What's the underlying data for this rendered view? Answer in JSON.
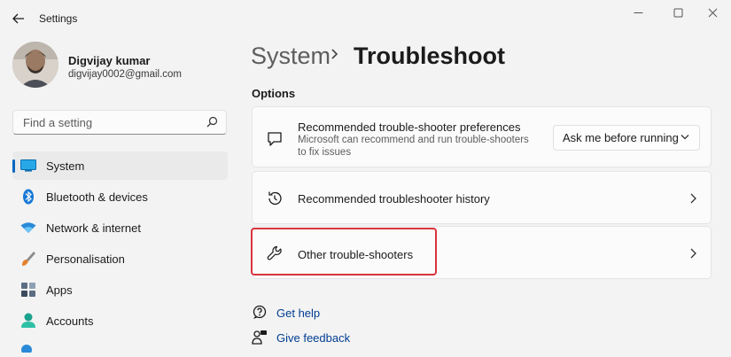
{
  "window": {
    "title": "Settings",
    "controls": [
      "minimize-icon",
      "maximize-icon",
      "close-icon"
    ]
  },
  "profile": {
    "name": "Digvijay kumar",
    "email": "digvijay0002@gmail.com"
  },
  "search": {
    "placeholder": "Find a setting",
    "value": ""
  },
  "nav": {
    "items": [
      {
        "label": "System",
        "icon": "system-display-icon",
        "active": true
      },
      {
        "label": "Bluetooth & devices",
        "icon": "bluetooth-icon",
        "active": false
      },
      {
        "label": "Network & internet",
        "icon": "wifi-icon",
        "active": false
      },
      {
        "label": "Personalisation",
        "icon": "paintbrush-icon",
        "active": false
      },
      {
        "label": "Apps",
        "icon": "apps-icon",
        "active": false
      },
      {
        "label": "Accounts",
        "icon": "person-icon",
        "active": false
      }
    ]
  },
  "breadcrumb": {
    "parent": "System",
    "current": "Troubleshoot"
  },
  "options": {
    "heading": "Options",
    "preferences": {
      "title": "Recommended trouble-shooter preferences",
      "description": "Microsoft can recommend and run trouble-shooters to fix issues",
      "icon": "chat-bubble-icon",
      "dropdown_value": "Ask me before running"
    },
    "history": {
      "title": "Recommended troubleshooter history",
      "icon": "history-icon"
    },
    "other": {
      "title": "Other trouble-shooters",
      "icon": "wrench-icon"
    }
  },
  "links": {
    "help": "Get help",
    "feedback": "Give feedback"
  },
  "colors": {
    "accent": "#0067c0",
    "highlight": "#d9343d",
    "link": "#003e92"
  }
}
